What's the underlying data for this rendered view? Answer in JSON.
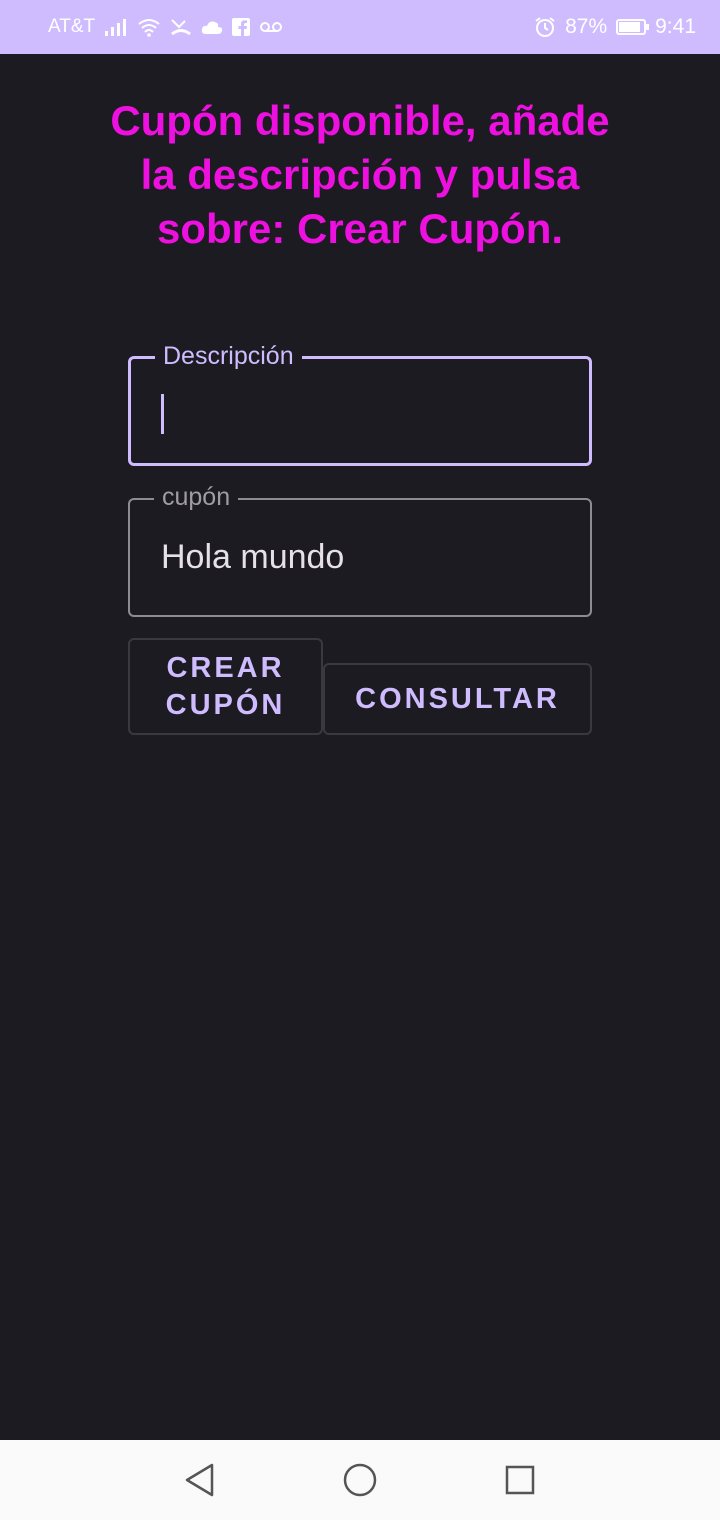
{
  "status_bar": {
    "carrier": "AT&T",
    "battery_percent": "87%",
    "battery_level": 0.87,
    "time": "9:41",
    "icons": [
      "signal-icon",
      "wifi-icon",
      "missed-call-icon",
      "cloud-icon",
      "facebook-icon",
      "voicemail-icon",
      "alarm-icon",
      "battery-icon"
    ]
  },
  "main": {
    "title": "Cupón disponible, añade la descripción y pulsa sobre: Crear Cupón.",
    "description_field": {
      "label": "Descripción",
      "value": ""
    },
    "coupon_field": {
      "label": "cupón",
      "value": "Hola mundo"
    },
    "create_button_label": "CREAR CUPÓN",
    "consult_button_label": "CONSULTAR"
  },
  "nav_bar": {
    "icons": [
      "back-icon",
      "home-icon",
      "recents-icon"
    ]
  },
  "colors": {
    "background": "#1c1b21",
    "status_bar": "#cfbcff",
    "accent": "#cfbcff",
    "title": "#ee10e0"
  }
}
